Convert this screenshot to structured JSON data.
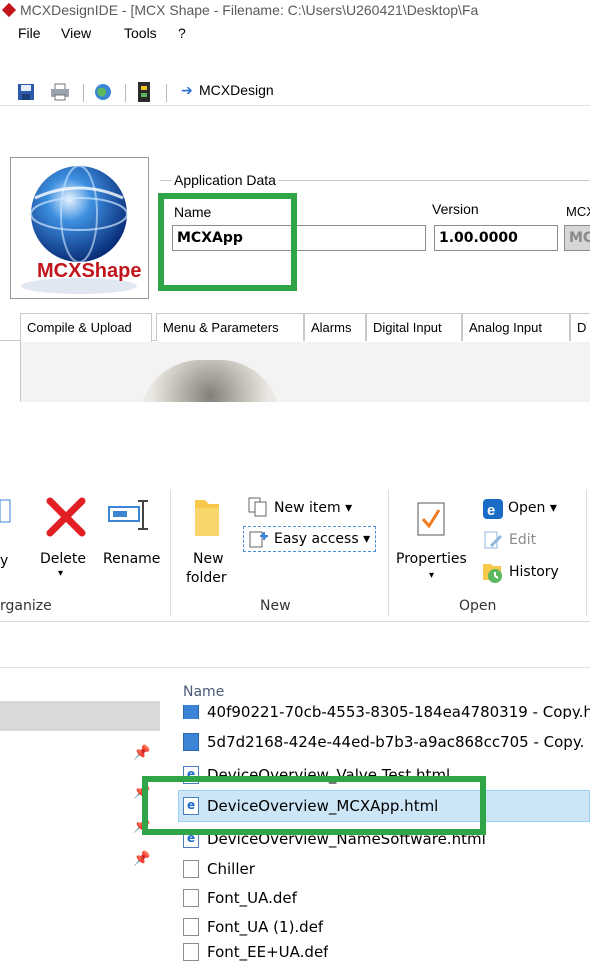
{
  "window": {
    "title": "MCXDesignIDE - [MCX Shape  -  Filename: C:\\Users\\U260421\\Desktop\\Fa"
  },
  "menubar": [
    "File",
    "View",
    "Tools",
    "?"
  ],
  "toolbar": {
    "icons": [
      "save-icon",
      "print-icon",
      "web-icon",
      "device-icon"
    ],
    "link_label": "MCXDesign"
  },
  "logo": {
    "text": "MCXShape"
  },
  "app_data": {
    "legend": "Application Data",
    "name_label": "Name",
    "name_value": "MCXApp",
    "version_label": "Version",
    "version_value": "1.00.0000",
    "mcx_label": "MCX",
    "mcx_value": "MC"
  },
  "tabs": [
    "Compile & Upload",
    "Menu & Parameters",
    "Alarms",
    "Digital Input",
    "Analog Input",
    "D"
  ],
  "ribbon": {
    "organize": {
      "cut_label": "y",
      "delete": "Delete",
      "rename": "Rename",
      "group": "rganize"
    },
    "new": {
      "new_folder_line1": "New",
      "new_folder_line2": "folder",
      "new_item": "New item ▾",
      "easy_access": "Easy access ▾",
      "group": "New"
    },
    "open": {
      "properties": "Properties",
      "open": "Open ▾",
      "edit": "Edit",
      "history": "History",
      "group": "Open"
    }
  },
  "explorer": {
    "column_name": "Name",
    "files": [
      {
        "name": "40f90221-70cb-4553-8305-184ea4780319 - Copy.h",
        "icon": "image-icon"
      },
      {
        "name": "5d7d2168-424e-44ed-b7b3-a9ac868cc705 - Copy.",
        "icon": "image-icon"
      },
      {
        "name": "DeviceOverview_Valve Test.html",
        "icon": "html-icon"
      },
      {
        "name": "DeviceOverview_MCXApp.html",
        "icon": "html-icon",
        "selected": true
      },
      {
        "name": "DeviceOverview_NameSoftware.html",
        "icon": "html-icon"
      },
      {
        "name": "Chiller",
        "icon": "file-icon"
      },
      {
        "name": "Font_UA.def",
        "icon": "file-icon"
      },
      {
        "name": "Font_UA (1).def",
        "icon": "file-icon"
      },
      {
        "name": "Font_EE+UA.def",
        "icon": "file-icon"
      }
    ]
  },
  "colors": {
    "highlight": "#2fa548",
    "selection": "#cde6f7"
  }
}
